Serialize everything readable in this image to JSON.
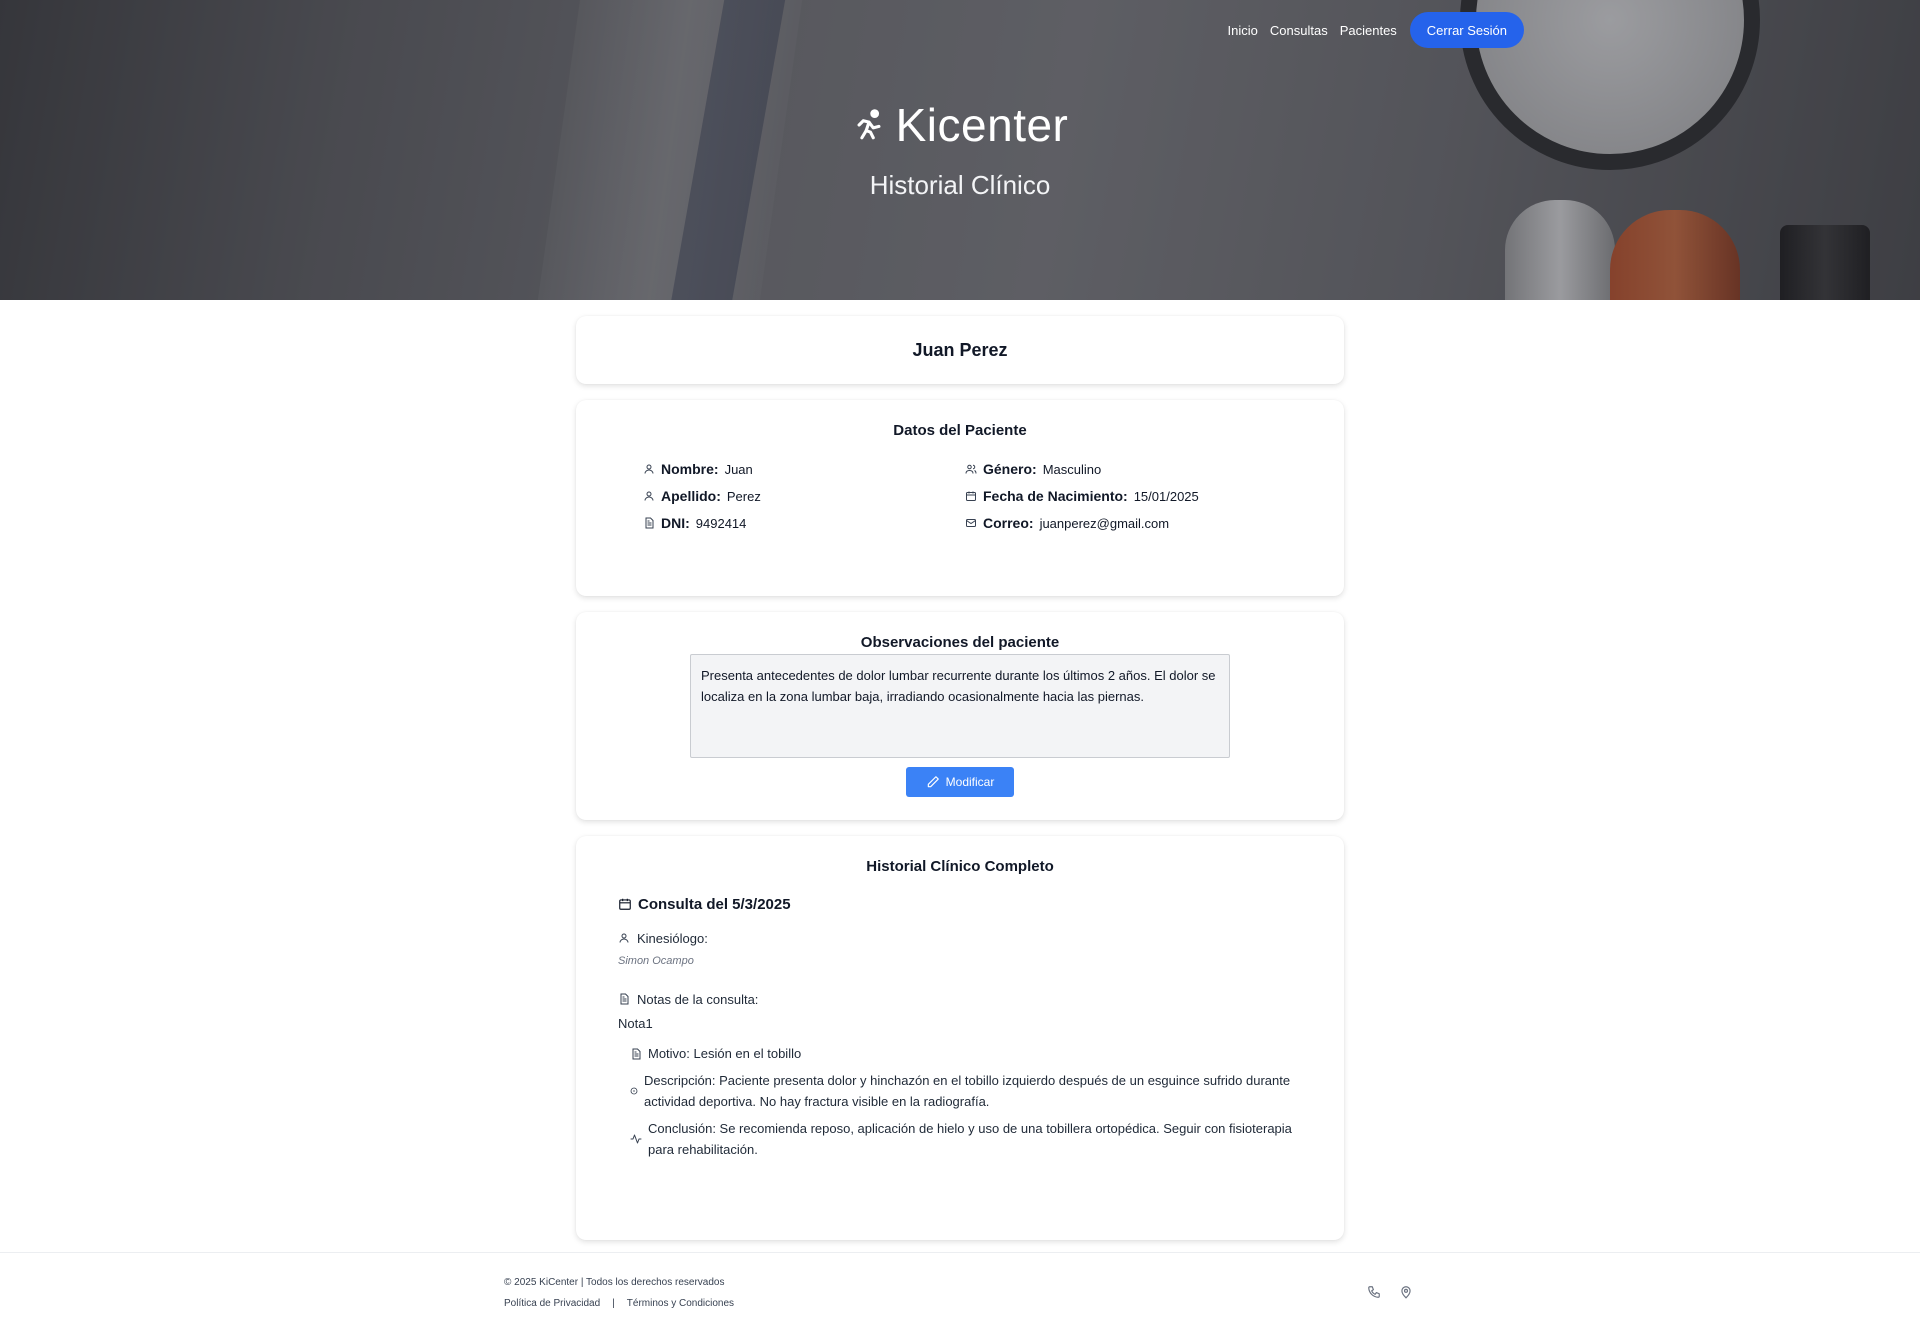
{
  "nav": {
    "inicio": "Inicio",
    "consultas": "Consultas",
    "pacientes": "Pacientes",
    "logout": "Cerrar Sesión"
  },
  "brand": {
    "name": "Kicenter",
    "subtitle": "Historial Clínico"
  },
  "patient_name": "Juan Perez",
  "datos": {
    "title": "Datos del Paciente",
    "fields": [
      {
        "label": "Nombre:",
        "value": "Juan",
        "icon": "user-icon"
      },
      {
        "label": "Género:",
        "value": "Masculino",
        "icon": "users-icon"
      },
      {
        "label": "Apellido:",
        "value": "Perez",
        "icon": "user-icon"
      },
      {
        "label": "Fecha de Nacimiento:",
        "value": "15/01/2025",
        "icon": "calendar-icon"
      },
      {
        "label": "DNI:",
        "value": "9492414",
        "icon": "document-icon"
      },
      {
        "label": "Correo:",
        "value": "juanperez@gmail.com",
        "icon": "mail-icon"
      }
    ]
  },
  "observaciones": {
    "title": "Observaciones del paciente",
    "text": "Presenta antecedentes de dolor lumbar recurrente durante los últimos 2 años. El dolor se localiza en la zona lumbar baja, irradiando ocasionalmente hacia las piernas.",
    "button": "Modificar"
  },
  "historial": {
    "title": "Historial Clínico Completo",
    "consulta_title": "Consulta del 5/3/2025",
    "kinesiologo_label": "Kinesiólogo:",
    "kinesiologo_name": "Simon Ocampo",
    "notas_label": "Notas de la consulta:",
    "nota_title": "Nota1",
    "motivo": "Motivo: Lesión en el tobillo",
    "descripcion": "Descripción: Paciente presenta dolor y hinchazón en el tobillo izquierdo después de un esguince sufrido durante actividad deportiva. No hay fractura visible en la radiografía.",
    "conclusion": "Conclusión: Se recomienda reposo, aplicación de hielo y uso de una tobillera ortopédica. Seguir con fisioterapia para rehabilitación."
  },
  "footer": {
    "copyright": "© 2025 KiCenter | Todos los derechos reservados",
    "privacy": "Política de Privacidad",
    "separator": "|",
    "terms": "Términos y Condiciones"
  },
  "colors": {
    "accent": "#2563eb",
    "button": "#3b82f6"
  }
}
